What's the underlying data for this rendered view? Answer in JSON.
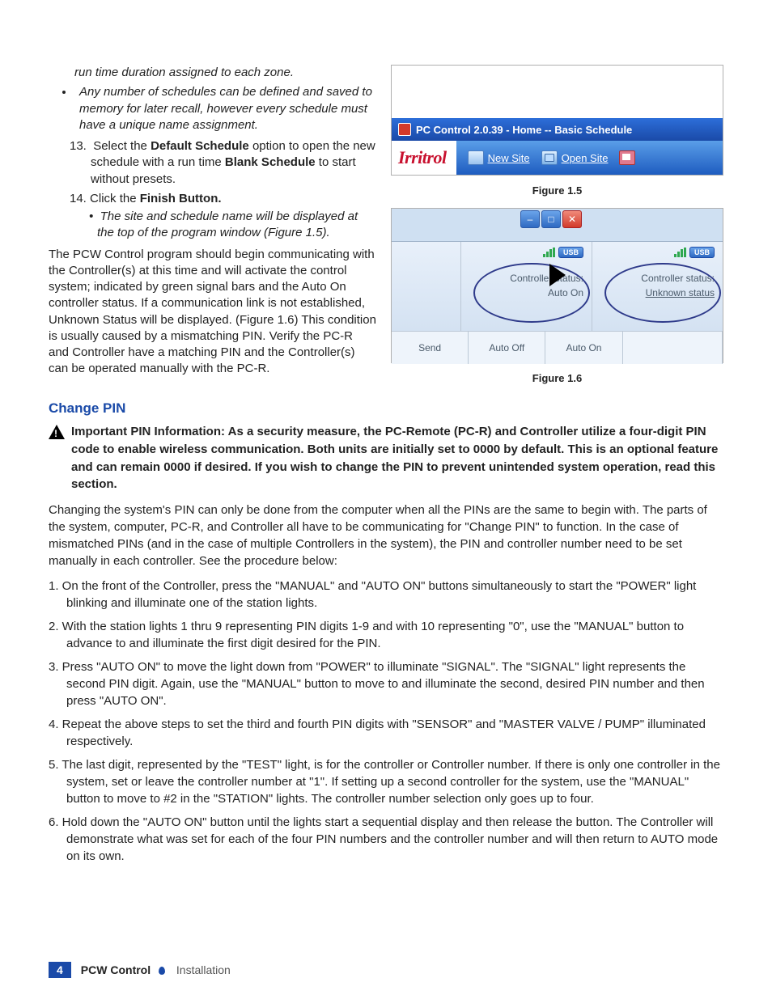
{
  "leftCol": {
    "bullets_top": [
      "run time duration assigned to each zone.",
      "Any number of schedules can be defined and saved to memory for later recall, however every schedule must have a unique name assignment."
    ],
    "step13_pre": "Select the ",
    "step13_b1": "Default Schedule",
    "step13_mid": " option to open the new schedule with a run time ",
    "step13_b2": "Blank Schedule",
    "step13_post": " to start without presets.",
    "step14_pre": "Click the ",
    "step14_b": "Finish Button.",
    "step14_sub": "The site and schedule name will be displayed at the top of the program window (Figure 1.5).",
    "para": "The PCW Control program should begin communicating with the Controller(s) at this time and will activate the control system; indicated by green signal bars and the Auto On controller status. If a communication link is not established, Unknown Status will be displayed. (Figure 1.6) This condition is usually caused by a mismatching PIN. Verify the PC-R and Controller have a matching PIN and the Controller(s) can be operated manually with the PC-R."
  },
  "fig15": {
    "caption": "Figure 1.5",
    "titlebar": "PC Control 2.0.39  -  Home  --  Basic Schedule",
    "brand": "Irritrol",
    "new_site": "New Site",
    "open_site": "Open Site"
  },
  "fig16": {
    "caption": "Figure 1.6",
    "usb": "USB",
    "status_label": "Controller status:",
    "status_auto": "Auto On",
    "status_unknown": "Unknown status",
    "btn_send": "Send",
    "btn_auto_off": "Auto Off",
    "btn_auto_on": "Auto On"
  },
  "changePin": {
    "heading": "Change PIN",
    "important_label": "Important PIN Information:",
    "important_text": " As a security measure, the PC-Remote (PC-R) and Controller utilize a four-digit PIN code to enable wireless communication. Both units are initially set to 0000 by default. This is an optional feature and can remain 0000 if desired. If you wish to change the PIN to prevent unintended system operation, read this section.",
    "intro": "Changing the system's PIN can only be done from the computer when all the PINs are the same to begin with. The parts of the system, computer, PC-R, and Controller all have to be communicating for \"Change PIN\" to function. In the case of mismatched PINs (and in the case of multiple Controllers in the system), the PIN and controller number need to be set manually in each controller. See the procedure below:",
    "steps": [
      "1. On the front of the Controller, press the \"MANUAL\" and \"AUTO ON\" buttons simultaneously to start the \"POWER\" light blinking and illuminate one of the station lights.",
      "2. With the station lights 1 thru 9 representing PIN digits 1-9 and with 10 representing \"0\", use the \"MANUAL\" button to advance to and illuminate the first digit desired for the PIN.",
      "3. Press \"AUTO ON\" to move the light down from \"POWER\" to illuminate \"SIGNAL\". The \"SIGNAL\" light represents the second PIN digit. Again, use the \"MANUAL\" button to move to and illuminate the second, desired PIN number and then press \"AUTO ON\".",
      "4. Repeat the above steps to set the third and fourth PIN digits with \"SENSOR\" and \"MASTER VALVE / PUMP\" illuminated respectively.",
      "5. The last digit, represented by the \"TEST\" light, is for the controller or Controller number. If there is only one controller in the system, set or leave the controller number at \"1\". If setting up a second controller for the system, use the \"MANUAL\" button to move to #2 in the \"STATION\" lights. The controller number selection only goes up to four.",
      "6. Hold down the \"AUTO ON\" button until the lights start a sequential display and then release the button. The Controller will demonstrate what was set for each of the four PIN numbers and the controller number and will then return to AUTO mode on its own."
    ]
  },
  "footer": {
    "page": "4",
    "title": "PCW Control",
    "section": "Installation"
  }
}
